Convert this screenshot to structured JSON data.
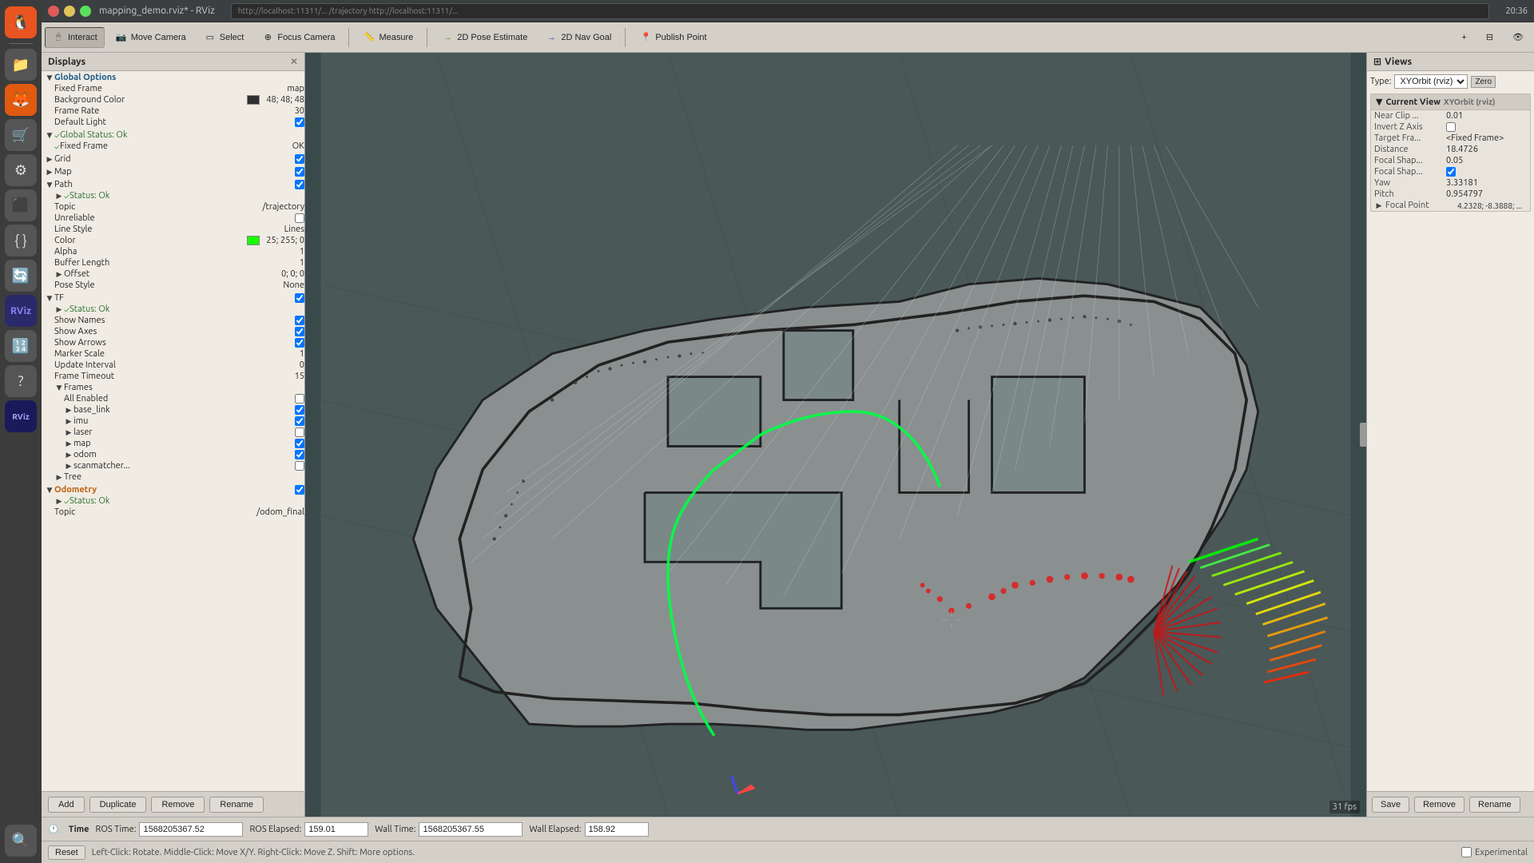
{
  "window": {
    "title": "mapping_demo.rviz* - RViz",
    "url": "http://localhost:11311/... /trajectory http://localhost:11311/...",
    "time": "20:36"
  },
  "toolbar": {
    "interact_label": "Interact",
    "move_camera_label": "Move Camera",
    "select_label": "Select",
    "focus_camera_label": "Focus Camera",
    "measure_label": "Measure",
    "pose_estimate_label": "2D Pose Estimate",
    "nav_goal_label": "2D Nav Goal",
    "publish_point_label": "Publish Point"
  },
  "displays": {
    "header": "Displays",
    "global_options": {
      "label": "Global Options",
      "fixed_frame_label": "Fixed Frame",
      "fixed_frame_value": "map",
      "bg_color_label": "Background Color",
      "bg_color_value": "48; 48; 48",
      "frame_rate_label": "Frame Rate",
      "frame_rate_value": "30",
      "default_light_label": "Default Light",
      "default_light_checked": true
    },
    "global_status": {
      "label": "Global Status: Ok",
      "fixed_frame_label": "Fixed Frame",
      "fixed_frame_value": "OK"
    },
    "grid": {
      "label": "Grid",
      "checked": true
    },
    "map": {
      "label": "Map",
      "checked": true
    },
    "path": {
      "label": "Path",
      "checked": true,
      "status_label": "Status: Ok",
      "topic_label": "Topic",
      "topic_value": "/trajectory",
      "unreliable_label": "Unreliable",
      "unreliable_checked": false,
      "line_style_label": "Line Style",
      "line_style_value": "Lines",
      "color_label": "Color",
      "color_value": "25; 255; 0",
      "alpha_label": "Alpha",
      "alpha_value": "1",
      "buffer_length_label": "Buffer Length",
      "buffer_length_value": "1",
      "offset_label": "Offset",
      "offset_value": "0; 0; 0",
      "pose_style_label": "Pose Style",
      "pose_style_value": "None"
    },
    "tf": {
      "label": "TF",
      "checked": true,
      "status_label": "Status: Ok",
      "show_names_label": "Show Names",
      "show_names_checked": true,
      "show_axes_label": "Show Axes",
      "show_axes_checked": true,
      "show_arrows_label": "Show Arrows",
      "show_arrows_checked": true,
      "marker_scale_label": "Marker Scale",
      "marker_scale_value": "1",
      "update_interval_label": "Update Interval",
      "update_interval_value": "0",
      "frame_timeout_label": "Frame Timeout",
      "frame_timeout_value": "15",
      "frames_label": "Frames",
      "all_enabled_label": "All Enabled",
      "all_enabled_checked": false,
      "base_link_label": "base_link",
      "base_link_checked": true,
      "imu_label": "imu",
      "imu_checked": true,
      "laser_label": "laser",
      "laser_checked": false,
      "map_label": "map",
      "map_checked": true,
      "odom_label": "odom",
      "odom_checked": true,
      "scanmatcher_label": "scanmatcher...",
      "scanmatcher_checked": false,
      "tree_label": "Tree"
    },
    "odometry": {
      "label": "Odometry",
      "checked": true,
      "status_label": "Status: Ok",
      "topic_label": "Topic",
      "topic_value": "/odom_final"
    },
    "footer": {
      "add_label": "Add",
      "duplicate_label": "Duplicate",
      "remove_label": "Remove",
      "rename_label": "Rename"
    }
  },
  "views": {
    "header": "Views",
    "type_label": "Type:",
    "type_value": "XYOrbit (rviz)",
    "zero_label": "Zero",
    "current_view_label": "Current View",
    "current_view_type": "XYOrbit (rviz)",
    "near_clip_label": "Near Clip ...",
    "near_clip_value": "0.01",
    "invert_z_label": "Invert Z Axis",
    "invert_z_checked": false,
    "target_frame_label": "Target Fra...",
    "target_frame_value": "<Fixed Frame>",
    "distance_label": "Distance",
    "distance_value": "18.4726",
    "focal_shape1_label": "Focal Shap...",
    "focal_shape1_value": "0.05",
    "focal_shape2_label": "Focal Shap...",
    "focal_shape2_checked": true,
    "yaw_label": "Yaw",
    "yaw_value": "3.33181",
    "pitch_label": "Pitch",
    "pitch_value": "0.954797",
    "focal_point_label": "Focal Point",
    "focal_point_value": "4.2328; -8.3888; ...",
    "footer": {
      "save_label": "Save",
      "remove_label": "Remove",
      "rename_label": "Rename"
    }
  },
  "statusbar": {
    "time_label": "Time",
    "ros_time_label": "ROS Time:",
    "ros_time_value": "1568205367.52",
    "ros_elapsed_label": "ROS Elapsed:",
    "ros_elapsed_value": "159.01",
    "wall_time_label": "Wall Time:",
    "wall_time_value": "1568205367.55",
    "wall_elapsed_label": "Wall Elapsed:",
    "wall_elapsed_value": "158.92"
  },
  "hintbar": {
    "reset_label": "Reset",
    "hint_text": "Left-Click: Rotate.  Middle-Click: Move X/Y.  Right-Click: Move Z.  Shift: More options.",
    "experimental_label": "Experimental"
  },
  "fps": "31 fps",
  "icons": {
    "interact": "🖱",
    "camera": "📷",
    "select": "▭",
    "focus": "⊕",
    "measure": "📏",
    "pose": "→",
    "nav": "🎯",
    "publish": "📍"
  }
}
